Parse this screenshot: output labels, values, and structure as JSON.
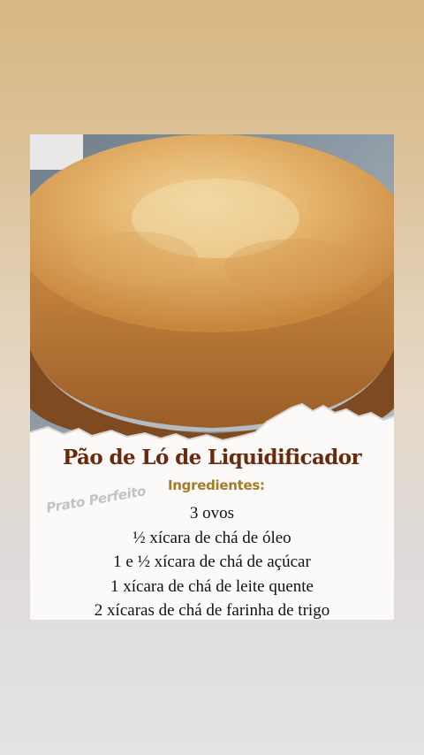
{
  "recipe": {
    "title": "Pão de Ló de Liquidificador",
    "ingredients_heading": "Ingredientes:",
    "ingredients": [
      "3 ovos",
      "½ xícara de chá de óleo",
      "1 e ½ xícara de chá de açúcar",
      "1 xícara de chá de leite quente",
      "2 xícaras de chá de farinha de trigo"
    ]
  },
  "watermark": "Prato Perfeito",
  "colors": {
    "title": "#6a2a10",
    "heading": "#a27c2a",
    "text": "#111111",
    "background_top": "#d7b781",
    "background_bottom": "#e3e2e5"
  },
  "icons": [
    "cake-photo",
    "torn-paper-edge"
  ]
}
